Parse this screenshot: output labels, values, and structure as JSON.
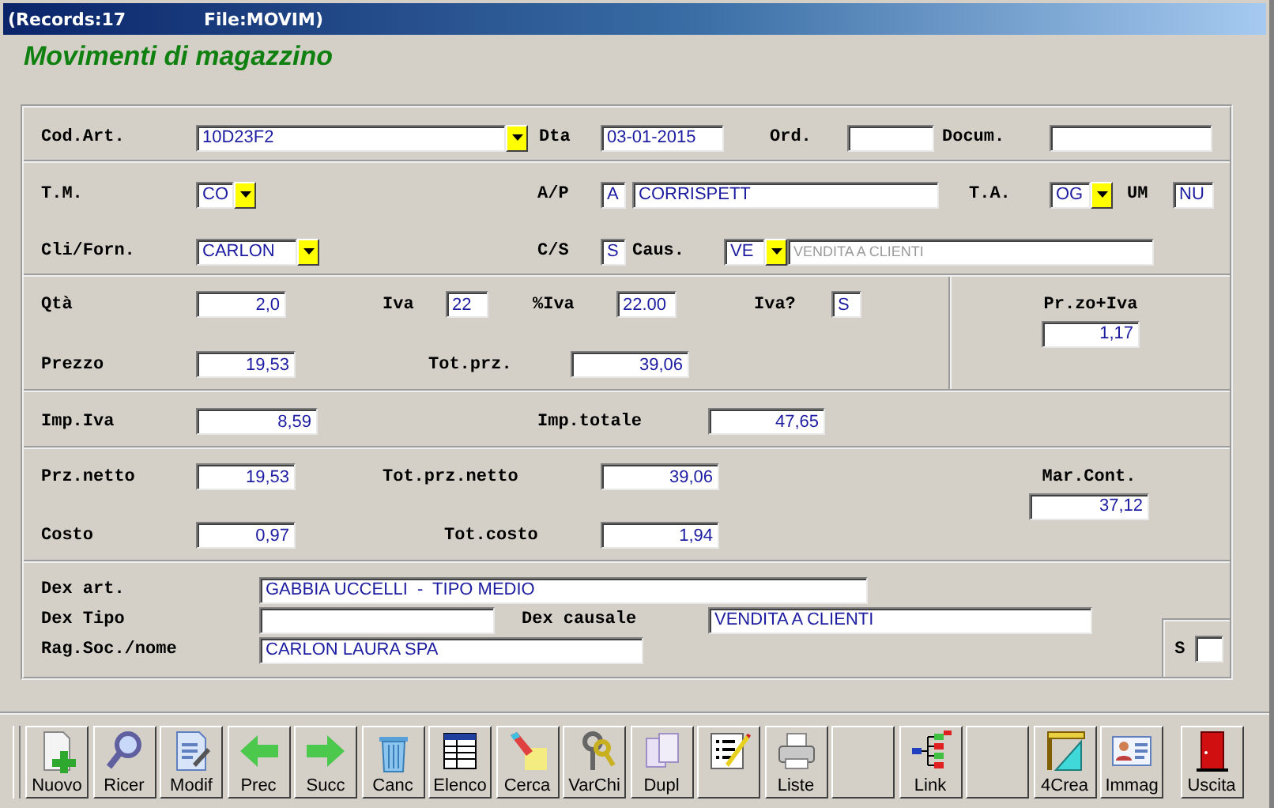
{
  "title_bar": {
    "records": "(Records:17",
    "file": "File:MOVIM)"
  },
  "heading": "Movimenti di magazzino",
  "sections": [
    {
      "rows": [
        [
          {
            "label": "Cod.Art.",
            "value": "10D23F2",
            "kind": "combo"
          },
          {
            "label": "Dta",
            "value": "03-01-2015",
            "kind": "text"
          },
          {
            "label": "Ord.",
            "kind": "text"
          },
          {
            "label": "Docum.",
            "kind": "text"
          }
        ]
      ]
    },
    {
      "rows": [
        [
          {
            "label": "T.M.",
            "value": "CO",
            "kind": "combo"
          },
          {
            "label": "A/P",
            "value": "A",
            "kind": "text"
          },
          {
            "value": "CORRISPETT",
            "kind": "text"
          },
          {
            "label": "T.A.",
            "value": "OG",
            "kind": "combo"
          },
          {
            "label": "UM",
            "value": "NU",
            "kind": "text"
          }
        ],
        [
          {
            "label": "Cli/Forn.",
            "value": "CARLON",
            "kind": "combo"
          },
          {
            "label": "C/S",
            "value": "S",
            "kind": "text"
          },
          {
            "label": "Caus.",
            "value": "VE",
            "kind": "combo"
          },
          {
            "value": "VENDITA A CLIENTI",
            "kind": "text",
            "disabled": true
          }
        ]
      ]
    },
    {
      "rows": [
        [
          {
            "label": "Qtà",
            "value": "2,0",
            "kind": "number"
          },
          {
            "label": "Iva",
            "value": "22",
            "kind": "text"
          },
          {
            "label": "%Iva",
            "value": "22.00",
            "kind": "text"
          },
          {
            "label": "Iva?",
            "value": "S",
            "kind": "text"
          }
        ],
        [
          {
            "label": "Prezzo",
            "value": "19,53",
            "kind": "number"
          },
          {
            "label": "Tot.prz.",
            "value": "39,06",
            "kind": "number"
          }
        ]
      ],
      "side": {
        "label": "Pr.zo+Iva",
        "value": "1,17",
        "kind": "number"
      }
    },
    {
      "rows": [
        [
          {
            "label": "Imp.Iva",
            "value": "8,59",
            "kind": "number"
          },
          {
            "label": "Imp.totale",
            "value": "47,65",
            "kind": "number"
          }
        ]
      ]
    },
    {
      "rows": [
        [
          {
            "label": "Prz.netto",
            "value": "19,53",
            "kind": "number"
          },
          {
            "label": "Tot.prz.netto",
            "value": "39,06",
            "kind": "number"
          }
        ],
        [
          {
            "label": "Costo",
            "value": "0,97",
            "kind": "number"
          },
          {
            "label": "Tot.costo",
            "value": "1,94",
            "kind": "number"
          }
        ]
      ],
      "side": {
        "label": "Mar.Cont.",
        "value": "37,12",
        "kind": "number"
      }
    },
    {
      "rows": [
        [
          {
            "label": "Dex art.",
            "value": "GABBIA UCCELLI  -  TIPO MEDIO",
            "kind": "text"
          }
        ],
        [
          {
            "label": "Dex Tipo",
            "kind": "text"
          },
          {
            "label": "Dex causale",
            "value": "VENDITA A CLIENTI",
            "kind": "text"
          }
        ],
        [
          {
            "label": "Rag.Soc./nome",
            "value": "CARLON LAURA SPA",
            "kind": "text"
          }
        ]
      ],
      "corner": {
        "label": "S",
        "kind": "text"
      }
    }
  ],
  "toolbar": [
    {
      "kind": "button",
      "label": "Nuovo"
    },
    {
      "kind": "button",
      "label": "Ricer"
    },
    {
      "kind": "button",
      "label": "Modif"
    },
    {
      "kind": "button",
      "label": "Prec"
    },
    {
      "kind": "button",
      "label": "Succ"
    },
    {
      "kind": "button",
      "label": "Canc"
    },
    {
      "kind": "button",
      "label": "Elenco"
    },
    {
      "kind": "button",
      "label": "Cerca"
    },
    {
      "kind": "button",
      "label": "VarChi"
    },
    {
      "kind": "button",
      "label": "Dupl"
    },
    {
      "kind": "icon"
    },
    {
      "kind": "button",
      "label": "Liste"
    },
    {
      "kind": "empty"
    },
    {
      "kind": "button",
      "label": "Link"
    },
    {
      "kind": "empty"
    },
    {
      "kind": "button",
      "label": "4Crea"
    },
    {
      "kind": "button",
      "label": "Immag"
    },
    {
      "kind": "button",
      "label": "Uscita"
    }
  ]
}
